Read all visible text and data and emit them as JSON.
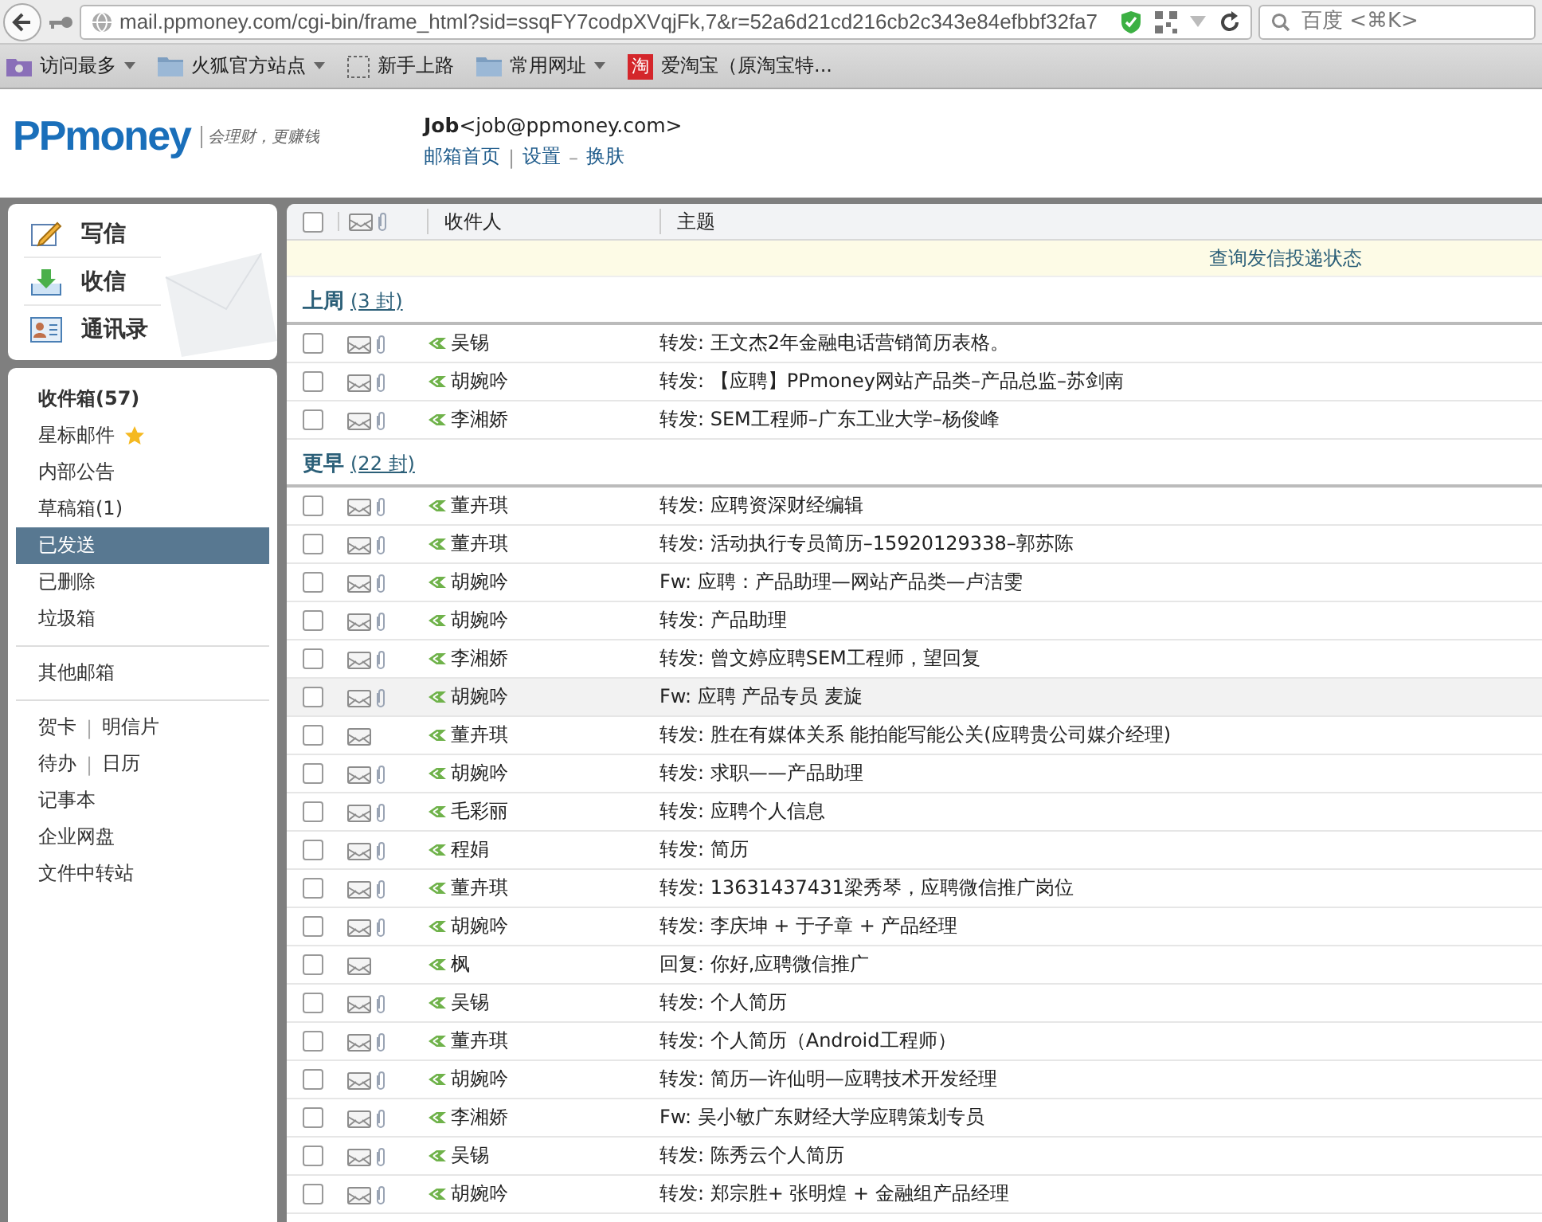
{
  "browser": {
    "url": "mail.ppmoney.com/cgi-bin/frame_html?sid=ssqFY7codpXVqjFk,7&r=52a6d21cd216cb2c343e84efbbf32fa7",
    "search_placeholder": "百度 <⌘K>"
  },
  "bookmarks": [
    {
      "label": "访问最多",
      "kind": "smart",
      "dropdown": true
    },
    {
      "label": "火狐官方站点",
      "kind": "folder",
      "dropdown": true
    },
    {
      "label": "新手上路",
      "kind": "page",
      "dropdown": false
    },
    {
      "label": "常用网址",
      "kind": "folder",
      "dropdown": true
    },
    {
      "label": "爱淘宝（原淘宝特...",
      "kind": "taobao",
      "dropdown": false,
      "badge": "淘"
    }
  ],
  "header": {
    "logo": "PPmoney",
    "tagline": "会理财，更赚钱",
    "user_name": "Job",
    "user_email": "<job@ppmoney.com>",
    "links": [
      {
        "label": "邮箱首页",
        "separator": "|"
      },
      {
        "label": "设置",
        "separator": "–"
      },
      {
        "label": "换肤"
      }
    ]
  },
  "quick_actions": [
    {
      "label": "写信",
      "kind": "compose"
    },
    {
      "label": "收信",
      "kind": "receive"
    },
    {
      "label": "通讯录",
      "kind": "contacts"
    }
  ],
  "folders": [
    {
      "label": "收件箱(57)",
      "selected": false,
      "bold": true,
      "starred": false
    },
    {
      "label": "星标邮件",
      "selected": false,
      "bold": false,
      "starred": true
    },
    {
      "label": "内部公告",
      "selected": false,
      "bold": false,
      "starred": false
    },
    {
      "label": "草稿箱(1)",
      "selected": false,
      "bold": false,
      "starred": false
    },
    {
      "label": "已发送",
      "selected": true,
      "bold": false,
      "starred": false
    },
    {
      "label": "已删除",
      "selected": false,
      "bold": false,
      "starred": false
    },
    {
      "label": "垃圾箱",
      "selected": false,
      "bold": false,
      "starred": false
    }
  ],
  "other_mailboxes": "其他邮箱",
  "tools": [
    [
      {
        "label": "贺卡",
        "separator": "|"
      },
      {
        "label": "明信片"
      }
    ],
    [
      {
        "label": "待办",
        "separator": "|"
      },
      {
        "label": "日历"
      }
    ],
    [
      {
        "label": "记事本"
      }
    ],
    [
      {
        "label": "企业网盘"
      }
    ],
    [
      {
        "label": "文件中转站"
      }
    ]
  ],
  "table": {
    "header_checked": false,
    "columns": [
      "收件人",
      "主题"
    ],
    "notice": "查询发信投递状态",
    "groups": [
      {
        "title": "上周",
        "count": "(3 封)",
        "rows": [
          {
            "recipient": "吴锡",
            "subject": "转发: 王文杰2年金融电话营销简历表格。",
            "attachment": true,
            "highlighted": false,
            "checked": false
          },
          {
            "recipient": "胡婉吟",
            "subject": "转发: 【应聘】PPmoney网站产品类–产品总监–苏剑南",
            "attachment": true,
            "highlighted": false,
            "checked": false
          },
          {
            "recipient": "李湘娇",
            "subject": "转发: SEM工程师–广东工业大学–杨俊峰",
            "attachment": true,
            "highlighted": false,
            "checked": false
          }
        ]
      },
      {
        "title": "更早",
        "count": "(22 封)",
        "rows": [
          {
            "recipient": "董卉琪",
            "subject": "转发: 应聘资深财经编辑",
            "attachment": true,
            "highlighted": false,
            "checked": false
          },
          {
            "recipient": "董卉琪",
            "subject": "转发: 活动执行专员简历–15920129338–郭苏陈",
            "attachment": true,
            "highlighted": false,
            "checked": false
          },
          {
            "recipient": "胡婉吟",
            "subject": "Fw: 应聘：产品助理—网站产品类—卢洁雯",
            "attachment": true,
            "highlighted": false,
            "checked": false
          },
          {
            "recipient": "胡婉吟",
            "subject": "转发: 产品助理",
            "attachment": true,
            "highlighted": false,
            "checked": false
          },
          {
            "recipient": "李湘娇",
            "subject": "转发: 曾文婷应聘SEM工程师，望回复",
            "attachment": true,
            "highlighted": false,
            "checked": false
          },
          {
            "recipient": "胡婉吟",
            "subject": "Fw: 应聘 产品专员 麦旋",
            "attachment": true,
            "highlighted": true,
            "checked": false
          },
          {
            "recipient": "董卉琪",
            "subject": "转发: 胜在有媒体关系 能拍能写能公关(应聘贵公司媒介经理)",
            "attachment": false,
            "highlighted": false,
            "checked": false
          },
          {
            "recipient": "胡婉吟",
            "subject": "转发: 求职——产品助理",
            "attachment": true,
            "highlighted": false,
            "checked": false
          },
          {
            "recipient": "毛彩丽",
            "subject": "转发: 应聘个人信息",
            "attachment": true,
            "highlighted": false,
            "checked": false
          },
          {
            "recipient": "程娟",
            "subject": "转发: 简历",
            "attachment": true,
            "highlighted": false,
            "checked": false
          },
          {
            "recipient": "董卉琪",
            "subject": "转发: 13631437431梁秀琴，应聘微信推广岗位",
            "attachment": true,
            "highlighted": false,
            "checked": false
          },
          {
            "recipient": "胡婉吟",
            "subject": "转发: 李庆坤 + 于子章 + 产品经理",
            "attachment": true,
            "highlighted": false,
            "checked": false
          },
          {
            "recipient": "枫",
            "subject": "回复: 你好,应聘微信推广",
            "attachment": false,
            "highlighted": false,
            "checked": false
          },
          {
            "recipient": "吴锡",
            "subject": "转发: 个人简历",
            "attachment": true,
            "highlighted": false,
            "checked": false
          },
          {
            "recipient": "董卉琪",
            "subject": "转发: 个人简历（Android工程师）",
            "attachment": true,
            "highlighted": false,
            "checked": false
          },
          {
            "recipient": "胡婉吟",
            "subject": "转发: 简历—许仙明—应聘技术开发经理",
            "attachment": true,
            "highlighted": false,
            "checked": false
          },
          {
            "recipient": "李湘娇",
            "subject": "Fw: 吴小敏广东财经大学应聘策划专员",
            "attachment": true,
            "highlighted": false,
            "checked": false
          },
          {
            "recipient": "吴锡",
            "subject": "转发: 陈秀云个人简历",
            "attachment": true,
            "highlighted": false,
            "checked": false
          },
          {
            "recipient": "胡婉吟",
            "subject": "转发: 郑宗胜+ 张明煌 + 金融组产品经理",
            "attachment": true,
            "highlighted": false,
            "checked": false
          }
        ]
      }
    ]
  }
}
